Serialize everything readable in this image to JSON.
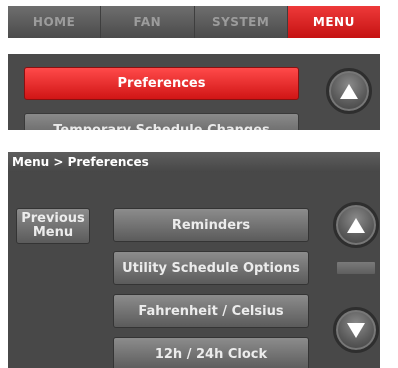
{
  "top_tabs": [
    {
      "label": "HOME",
      "active": false
    },
    {
      "label": "FAN",
      "active": false
    },
    {
      "label": "SYSTEM",
      "active": false
    },
    {
      "label": "MENU",
      "active": true
    }
  ],
  "preview": {
    "selected_label": "Preferences",
    "next_label": "Temporary Schedule Changes"
  },
  "menu": {
    "breadcrumb": "Menu > Preferences",
    "previous_label": "Previous Menu",
    "items": [
      {
        "label": "Reminders"
      },
      {
        "label": "Utility Schedule Options"
      },
      {
        "label": "Fahrenheit / Celsius"
      },
      {
        "label": "12h / 24h Clock"
      }
    ]
  },
  "icons": {
    "scroll_up": "triangle-up-icon",
    "scroll_down": "triangle-down-icon"
  },
  "colors": {
    "accent": "#d01515",
    "panel": "#484848",
    "text": "#ffffff"
  }
}
